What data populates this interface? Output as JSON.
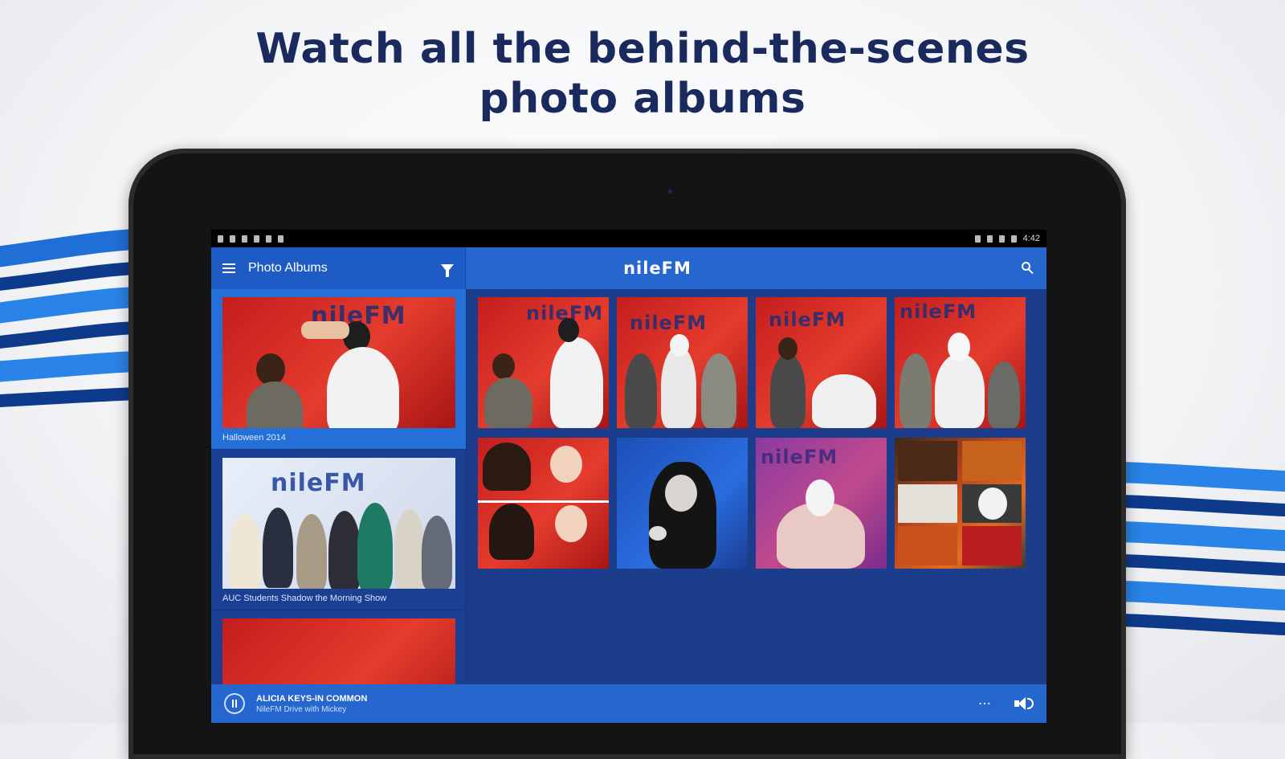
{
  "headline": {
    "line1": "Watch all the behind-the-scenes",
    "line2": "photo albums"
  },
  "status_bar": {
    "time": "4:42"
  },
  "app_bar": {
    "title": "Photo Albums",
    "brand": "nileFM",
    "icons": [
      "menu-icon",
      "filter-icon",
      "search-icon"
    ]
  },
  "sidebar": {
    "albums": [
      {
        "caption": "Halloween 2014",
        "selected": true
      },
      {
        "caption": "AUC Students Shadow the Morning Show",
        "selected": false
      },
      {
        "caption": "",
        "selected": false
      }
    ]
  },
  "grid": {
    "thumbnail_logo_text": "nileFM",
    "tile_count": 8
  },
  "player": {
    "title": "ALICIA KEYS-IN COMMON",
    "subtitle": "NileFM Drive with Mickey",
    "more_label": "⋯",
    "icons": [
      "pause-icon",
      "more-icon",
      "volume-icon"
    ]
  },
  "colors": {
    "headline": "#1a2a5e",
    "appbar": "#2566cf",
    "selected_album": "#2470d8",
    "screen_bg": "#1c3d8c"
  }
}
